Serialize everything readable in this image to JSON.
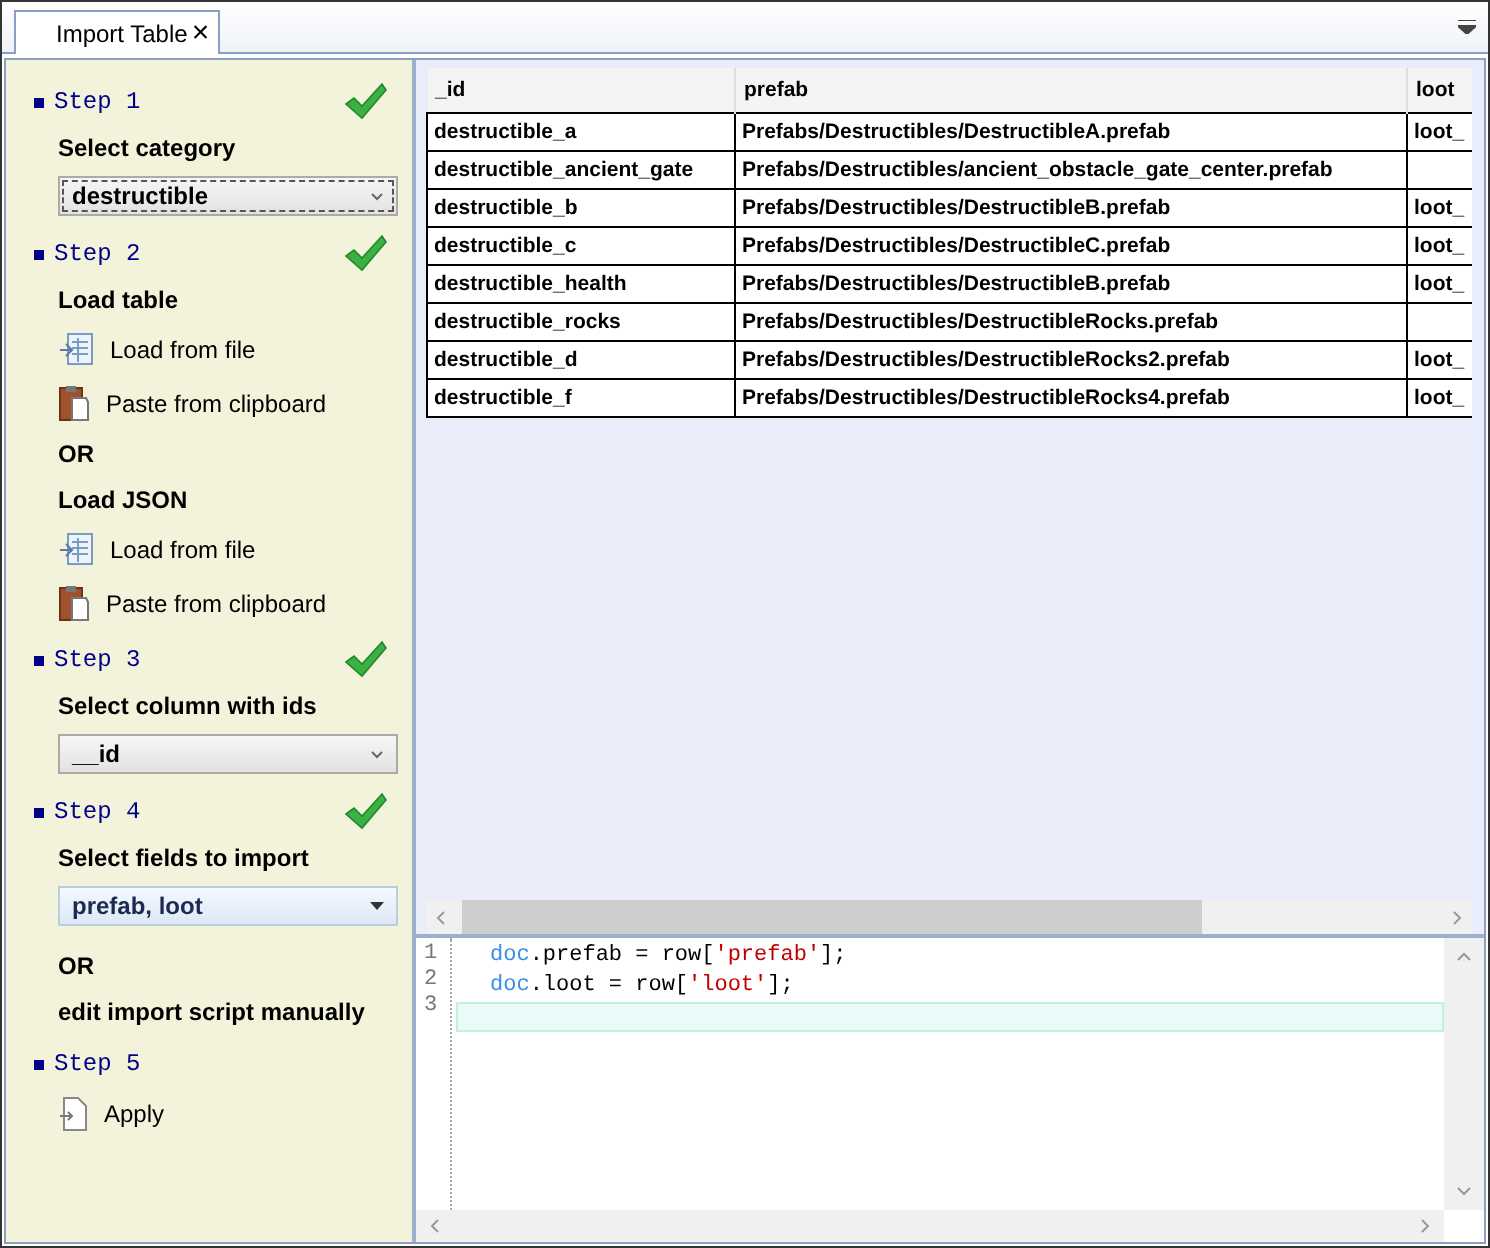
{
  "tab": {
    "title": "Import Table",
    "close": "×"
  },
  "steps": [
    {
      "label": "Step 1",
      "done": true,
      "items": [
        {
          "kind": "heading",
          "text": "Select category"
        },
        {
          "kind": "dropdown",
          "value": "destructible",
          "focused": true
        }
      ]
    },
    {
      "label": "Step 2",
      "done": true,
      "items": [
        {
          "kind": "heading",
          "text": "Load table"
        },
        {
          "kind": "load",
          "text": "Load from file"
        },
        {
          "kind": "paste",
          "text": "Paste from clipboard"
        },
        {
          "kind": "heading",
          "text": "OR"
        },
        {
          "kind": "heading",
          "text": "Load JSON"
        },
        {
          "kind": "load",
          "text": "Load from file"
        },
        {
          "kind": "paste",
          "text": "Paste from clipboard"
        }
      ]
    },
    {
      "label": "Step 3",
      "done": true,
      "items": [
        {
          "kind": "heading",
          "text": "Select column with ids"
        },
        {
          "kind": "dropdown",
          "value": "__id",
          "focused": false
        }
      ]
    },
    {
      "label": "Step 4",
      "done": true,
      "items": [
        {
          "kind": "heading",
          "text": "Select fields to import"
        },
        {
          "kind": "multiselect",
          "value": "prefab, loot"
        },
        {
          "kind": "heading",
          "text": "OR"
        },
        {
          "kind": "heading",
          "text": "edit import script manually"
        }
      ]
    },
    {
      "label": "Step 5",
      "done": false,
      "items": [
        {
          "kind": "apply",
          "text": "Apply"
        }
      ]
    }
  ],
  "table": {
    "columns": [
      "_id",
      "prefab",
      "loot"
    ],
    "rows": [
      [
        "destructible_a",
        "Prefabs/Destructibles/DestructibleA.prefab",
        "loot_"
      ],
      [
        "destructible_ancient_gate",
        "Prefabs/Destructibles/ancient_obstacle_gate_center.prefab",
        ""
      ],
      [
        "destructible_b",
        "Prefabs/Destructibles/DestructibleB.prefab",
        "loot_"
      ],
      [
        "destructible_c",
        "Prefabs/Destructibles/DestructibleC.prefab",
        "loot_"
      ],
      [
        "destructible_health",
        "Prefabs/Destructibles/DestructibleB.prefab",
        "loot_"
      ],
      [
        "destructible_rocks",
        "Prefabs/Destructibles/DestructibleRocks.prefab",
        ""
      ],
      [
        "destructible_d",
        "Prefabs/Destructibles/DestructibleRocks2.prefab",
        "loot_"
      ],
      [
        "destructible_f",
        "Prefabs/Destructibles/DestructibleRocks4.prefab",
        "loot_"
      ]
    ]
  },
  "editor": {
    "lines": [
      {
        "number": "1",
        "current": false,
        "tokens": [
          {
            "kind": "keyword",
            "text": "doc"
          },
          {
            "kind": "plain",
            "text": ".prefab = row["
          },
          {
            "kind": "string",
            "text": "'prefab'"
          },
          {
            "kind": "plain",
            "text": "];"
          }
        ]
      },
      {
        "number": "2",
        "current": false,
        "tokens": [
          {
            "kind": "keyword",
            "text": "doc"
          },
          {
            "kind": "plain",
            "text": ".loot = row["
          },
          {
            "kind": "string",
            "text": "'loot'"
          },
          {
            "kind": "plain",
            "text": "];"
          }
        ]
      },
      {
        "number": "3",
        "current": true
      }
    ]
  }
}
